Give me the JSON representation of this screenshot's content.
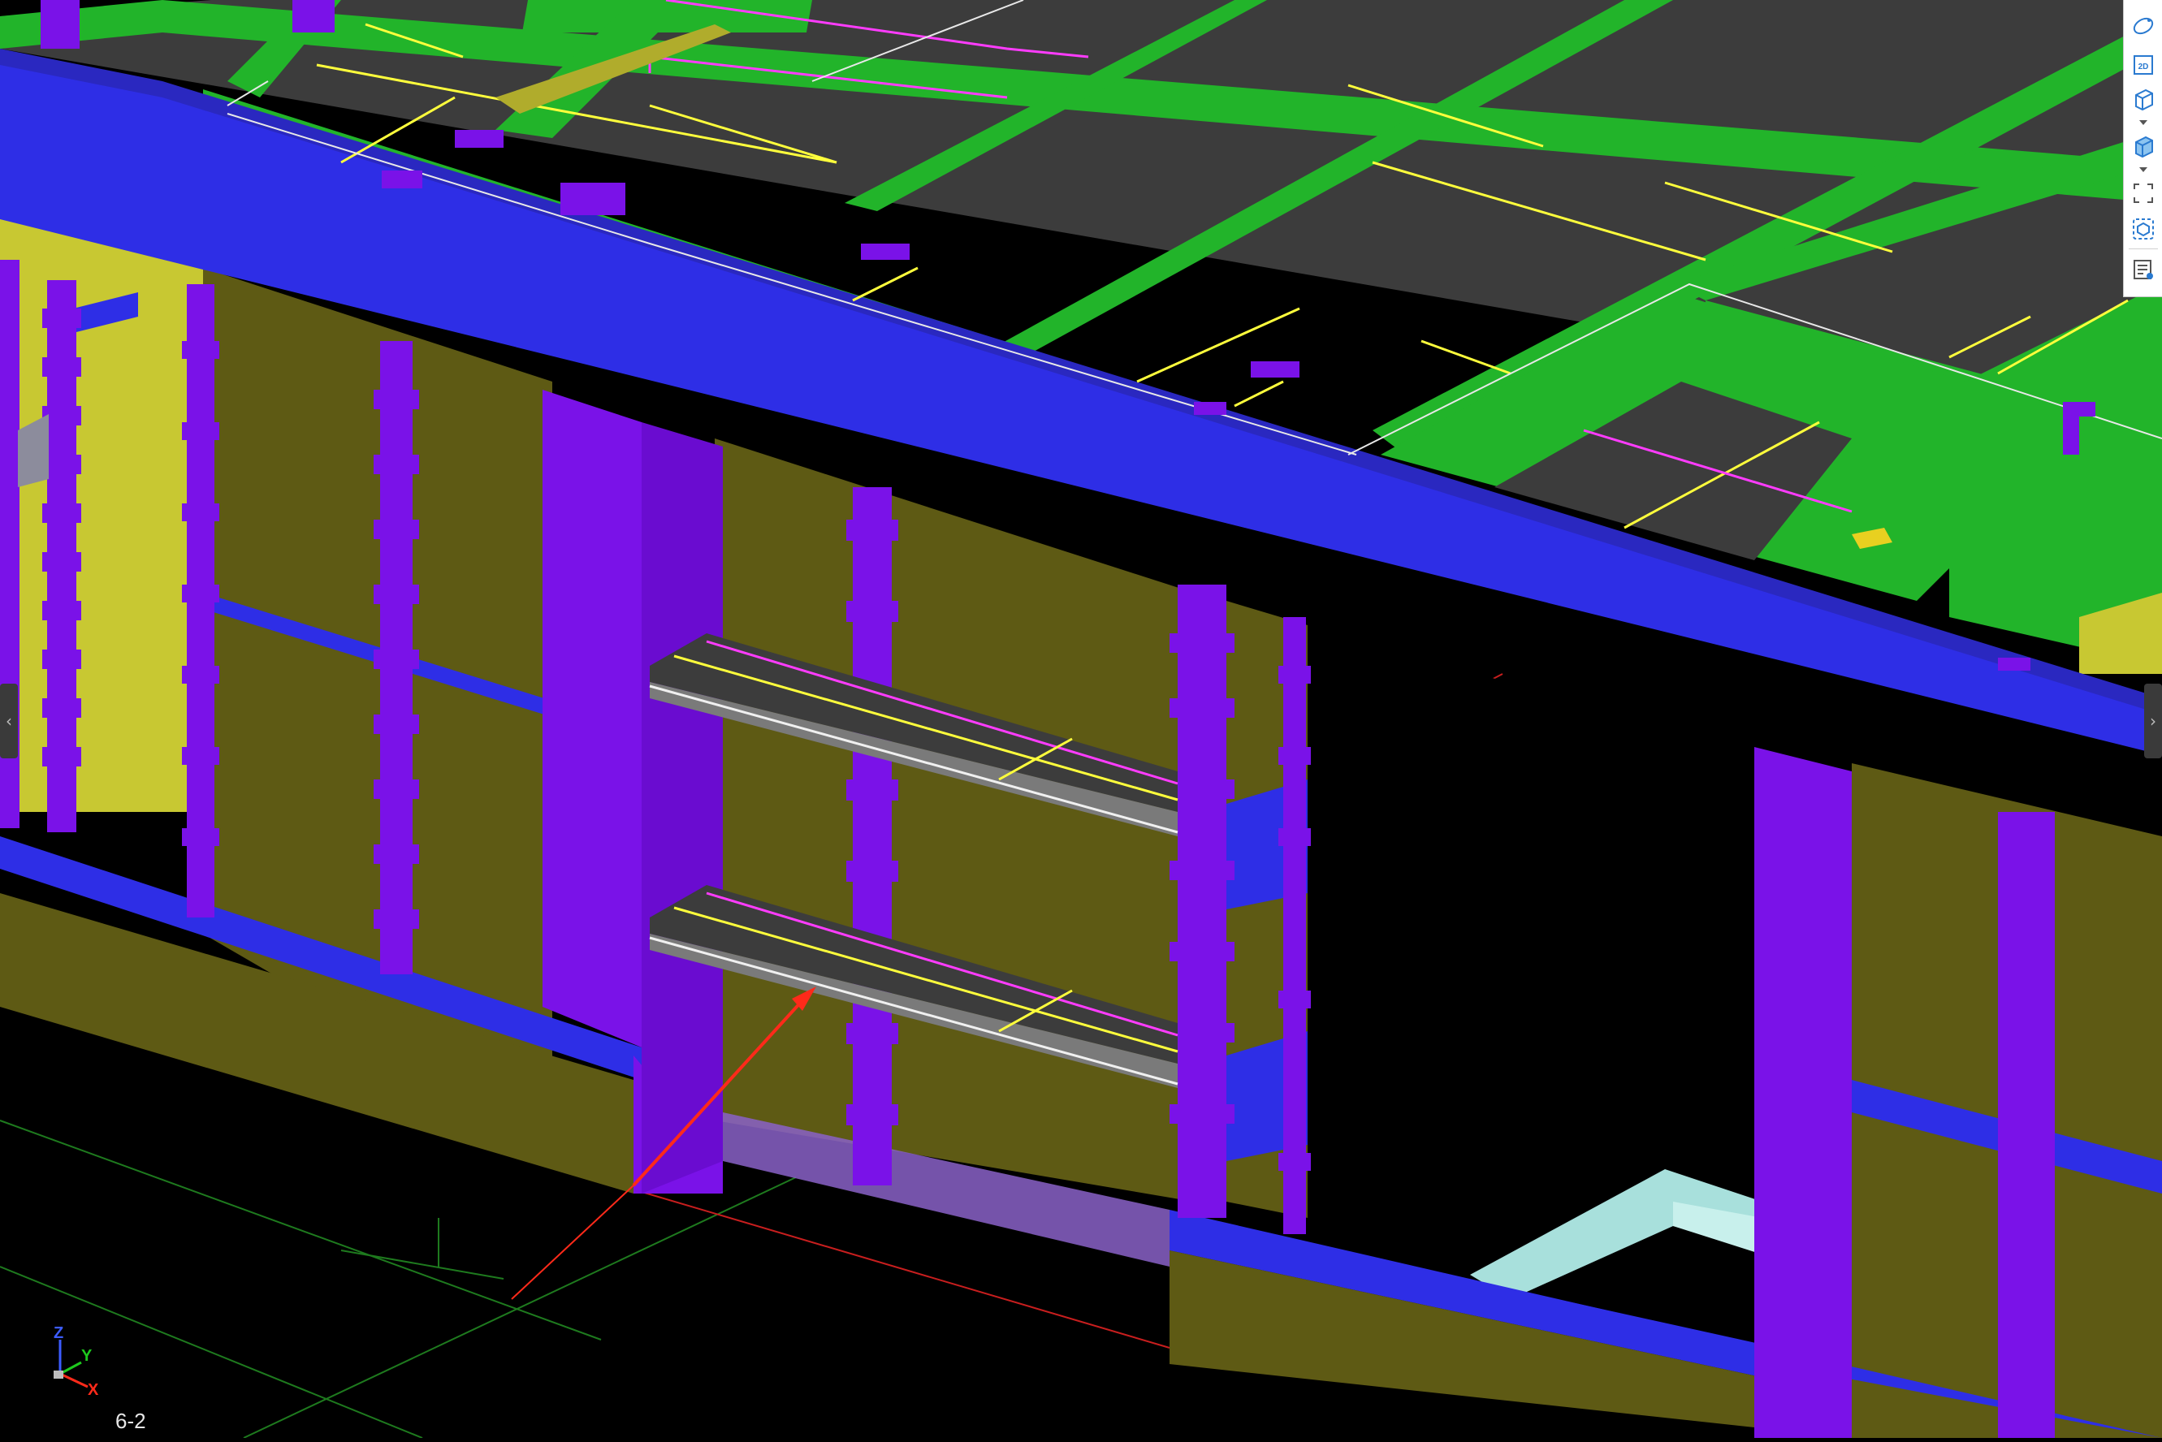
{
  "viewport": {
    "view_label": "6-2",
    "background": "#000000"
  },
  "axis_triad": {
    "z_label": "Z",
    "y_label": "Y",
    "x_label": "X"
  },
  "toolbar": {
    "items": [
      {
        "name": "orbit-icon"
      },
      {
        "name": "2d-view-icon",
        "text": "2D"
      },
      {
        "name": "wireframe-cube-icon"
      },
      {
        "name": "view-dropdown-chevron-icon"
      },
      {
        "name": "shaded-cube-icon"
      },
      {
        "name": "display-dropdown-chevron-icon"
      },
      {
        "name": "fit-view-icon"
      },
      {
        "name": "component-filter-icon"
      },
      {
        "name": "properties-panel-icon"
      }
    ]
  },
  "side_tabs": {
    "left_glyph": "‹",
    "right_glyph": "›"
  },
  "colors": {
    "beam_blue": "#2e2ee6",
    "column_violet": "#7a12e8",
    "slab_green": "#22b42a",
    "slab_dark": "#3c3c3c",
    "wall_olive": "#5e5a14",
    "wall_yellow": "#c8c832",
    "rebar_yellow": "#ffff3c",
    "rebar_magenta": "#ff3cff",
    "arrow_red": "#ff2a1a",
    "grid_green": "#1e7a1e"
  }
}
